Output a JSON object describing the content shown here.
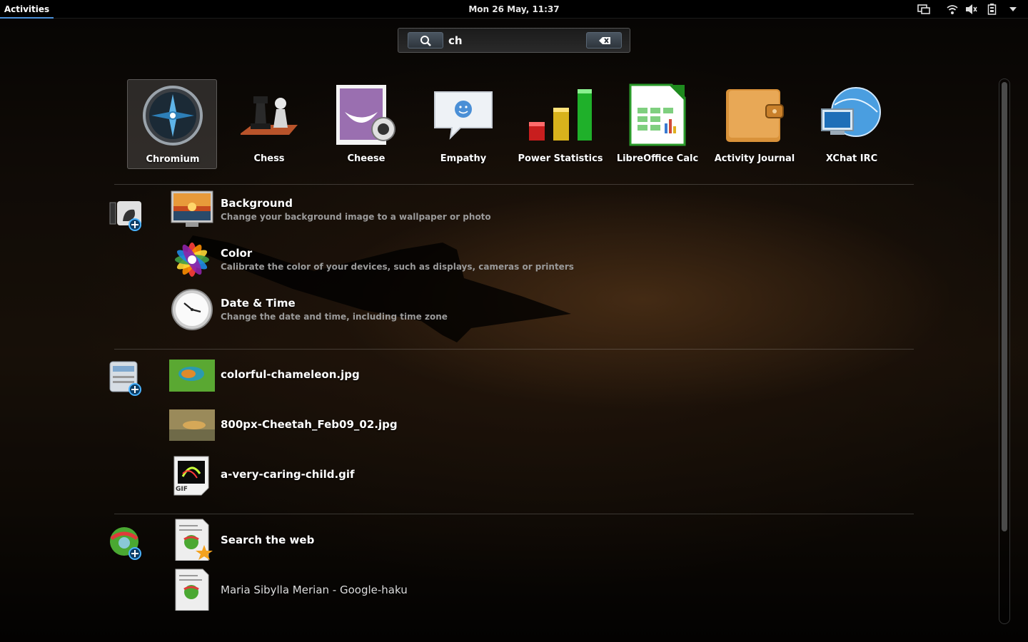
{
  "topbar": {
    "activities": "Activities",
    "clock": "Mon 26 May, 11:37"
  },
  "search": {
    "value": "ch",
    "icon": "search-icon",
    "clear_icon": "backspace-icon"
  },
  "apps": [
    {
      "label": "Chromium",
      "icon": "chromium-icon",
      "selected": true
    },
    {
      "label": "Chess",
      "icon": "chess-icon"
    },
    {
      "label": "Cheese",
      "icon": "cheese-icon"
    },
    {
      "label": "Empathy",
      "icon": "empathy-icon"
    },
    {
      "label": "Power Statistics",
      "icon": "power-statistics-icon"
    },
    {
      "label": "LibreOffice Calc",
      "icon": "libreoffice-calc-icon"
    },
    {
      "label": "Activity Journal",
      "icon": "activity-journal-icon"
    },
    {
      "label": "XChat IRC",
      "icon": "xchat-irc-icon"
    }
  ],
  "settings_results": [
    {
      "title": "Background",
      "desc": "Change your background image to a wallpaper or photo"
    },
    {
      "title": "Color",
      "desc": "Calibrate the color of your devices, such as displays, cameras or printers"
    },
    {
      "title": "Date & Time",
      "desc": "Change the date and time, including time zone"
    }
  ],
  "file_results": [
    {
      "title": "colorful-chameleon.jpg"
    },
    {
      "title": "800px-Cheetah_Feb09_02.jpg"
    },
    {
      "title": "a-very-caring-child.gif",
      "badge": "GIF"
    }
  ],
  "web_results": [
    {
      "title": "Search the web"
    },
    {
      "title": "Maria Sibylla Merian - Google-haku"
    }
  ],
  "colors": {
    "accent": "#4a90d9",
    "topbar": "#000000"
  }
}
